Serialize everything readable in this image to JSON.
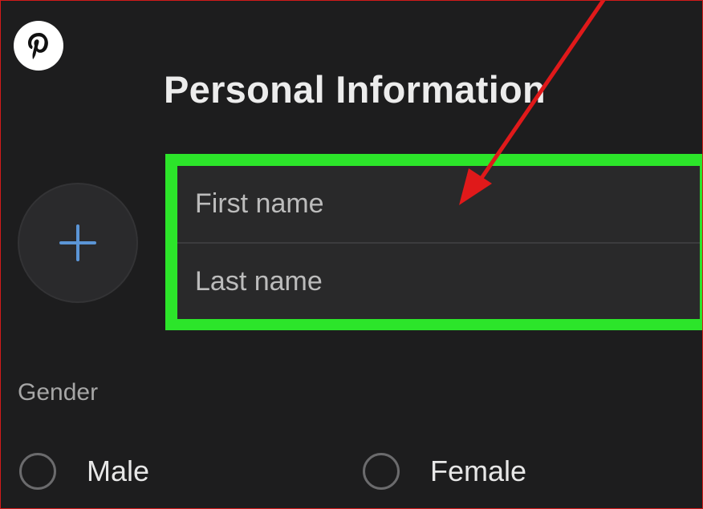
{
  "header": {
    "title": "Personal Information"
  },
  "profile_photo": {
    "icon": "plus-icon"
  },
  "name_fields": {
    "first": {
      "placeholder": "First name",
      "value": ""
    },
    "last": {
      "placeholder": "Last name",
      "value": ""
    }
  },
  "gender": {
    "label": "Gender",
    "options": [
      {
        "label": "Male",
        "selected": false
      },
      {
        "label": "Female",
        "selected": false
      }
    ]
  },
  "annotations": {
    "highlight_color": "#2ce52a",
    "arrow_color": "#e0191a",
    "frame_color": "#d11a1a"
  },
  "branding": {
    "icon": "pinterest-logo-icon"
  }
}
